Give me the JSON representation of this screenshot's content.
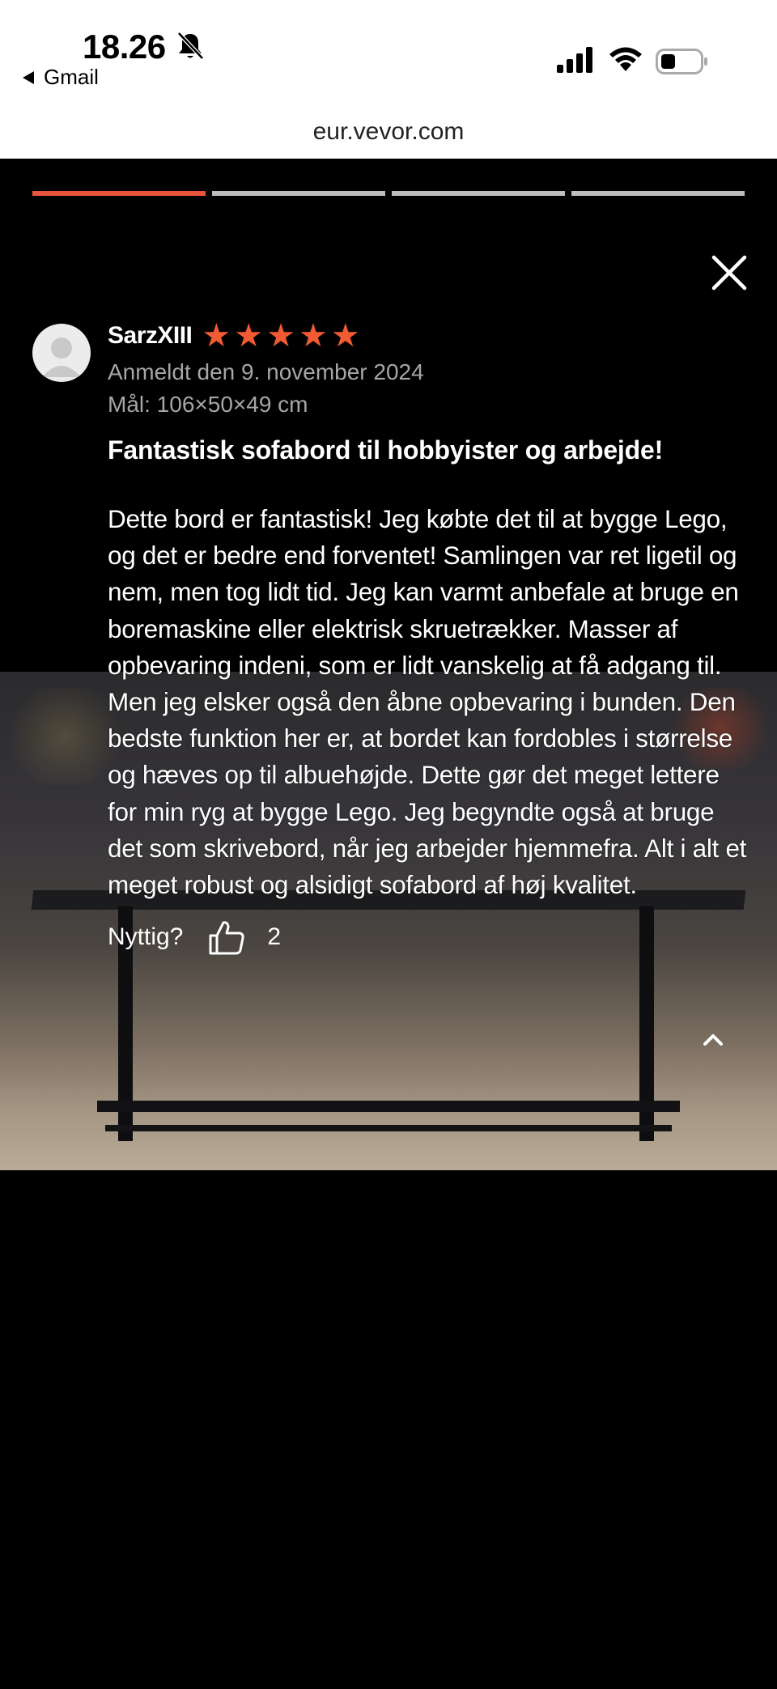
{
  "status_bar": {
    "time": "18.26",
    "back_app_label": "Gmail"
  },
  "browser": {
    "url": "eur.vevor.com"
  },
  "viewer": {
    "progress": {
      "total_segments": 4,
      "active_segment": 1
    },
    "accent_color": "#e8553a"
  },
  "review": {
    "author": "SarzXIII",
    "rating": 5,
    "date_label": "Anmeldt den 9. november 2024",
    "size_label": "Mål: 106×50×49 cm",
    "title": "Fantastisk sofabord til hobbyister og arbejde!",
    "body": "Dette bord er fantastisk! Jeg købte det til at bygge Lego, og det er bedre end forventet! Samlingen var ret ligetil og nem, men tog lidt tid. Jeg kan varmt anbefale at bruge en boremaskine eller elektrisk skruetrækker. Masser af opbevaring indeni, som er lidt vanskelig at få adgang til. Men jeg elsker også den åbne opbevaring i bunden. Den bedste funktion her er, at bordet kan fordobles i størrelse og hæves op til albuehøjde. Dette gør det meget lettere for min ryg at bygge Lego. Jeg begyndte også at bruge det som skrivebord, når jeg arbejder hjemmefra. Alt i alt et meget robust og alsidigt sofabord af høj kvalitet.",
    "helpful_label": "Nyttig?",
    "helpful_count": "2",
    "star_color": "#f15a33"
  }
}
